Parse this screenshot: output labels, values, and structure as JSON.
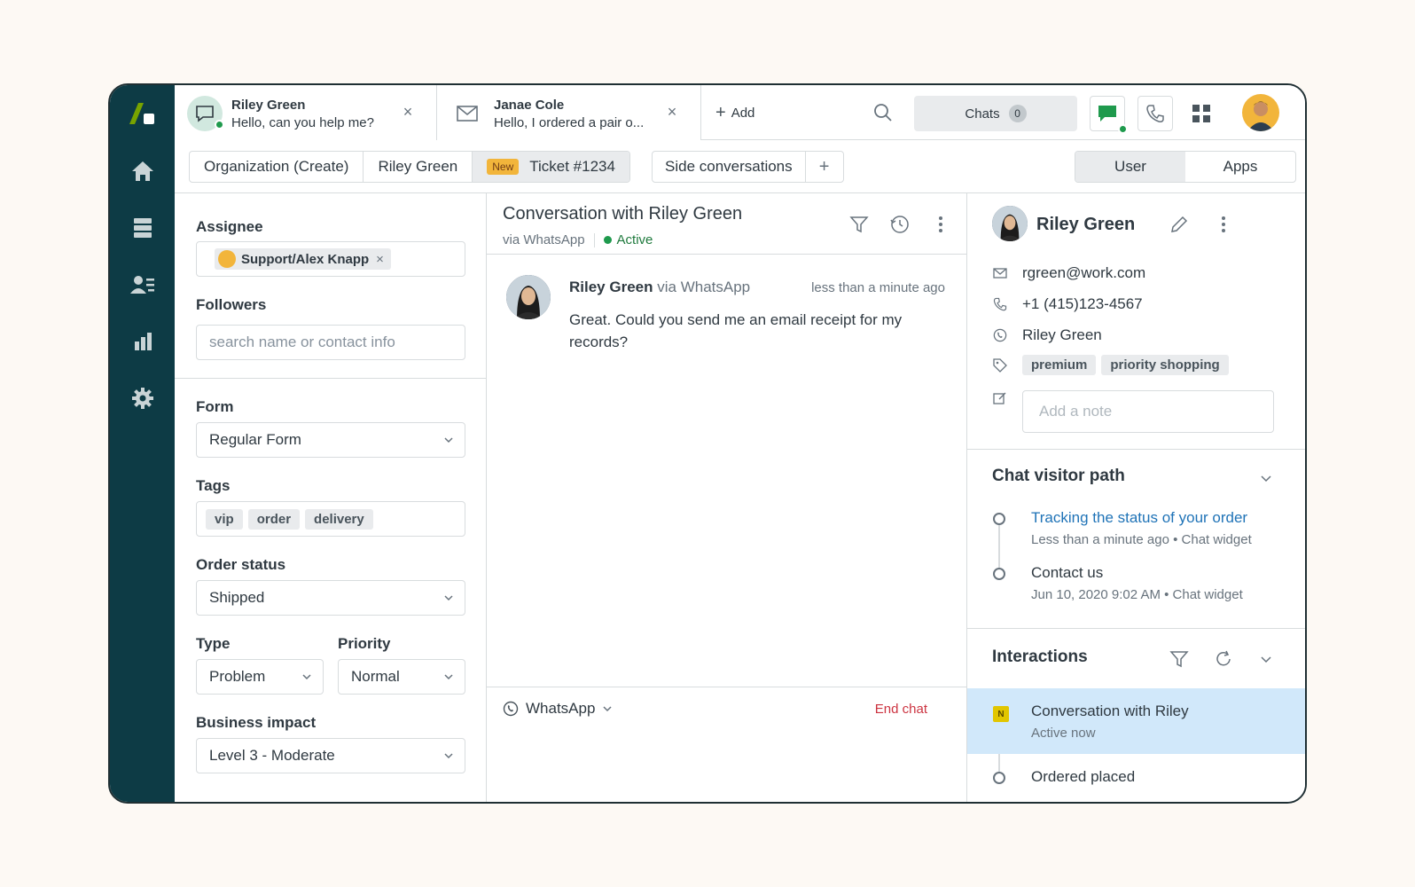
{
  "tabs": [
    {
      "name": "Riley Green",
      "preview": "Hello, can you help me?",
      "icon": "chat-bubble-icon"
    },
    {
      "name": "Janae Cole",
      "preview": "Hello, I ordered a pair o...",
      "icon": "mail-icon"
    }
  ],
  "topbar": {
    "add_label": "Add",
    "chats_label": "Chats",
    "chats_count": "0"
  },
  "subtabs": {
    "crumbs": [
      "Organization (Create)",
      "Riley Green"
    ],
    "ticket_badge": "New",
    "ticket_label": "Ticket #1234",
    "side_conversations": "Side conversations",
    "side_add": "+",
    "segments": [
      "User",
      "Apps"
    ]
  },
  "form": {
    "assignee_label": "Assignee",
    "assignee_value": "Support/Alex Knapp",
    "followers_label": "Followers",
    "followers_placeholder": "search name or contact info",
    "form_label": "Form",
    "form_value": "Regular Form",
    "tags_label": "Tags",
    "tags": [
      "vip",
      "order",
      "delivery"
    ],
    "order_status_label": "Order status",
    "order_status_value": "Shipped",
    "type_label": "Type",
    "type_value": "Problem",
    "priority_label": "Priority",
    "priority_value": "Normal",
    "business_impact_label": "Business impact",
    "business_impact_value": "Level 3 - Moderate"
  },
  "conversation": {
    "title": "Conversation with Riley Green",
    "via": "via WhatsApp",
    "status": "Active",
    "message": {
      "author": "Riley Green",
      "via": "via WhatsApp",
      "time": "less than a minute ago",
      "body": "Great. Could you send me an email receipt for my records?"
    },
    "channel": "WhatsApp",
    "end_chat": "End chat"
  },
  "user": {
    "name": "Riley Green",
    "email": "rgreen@work.com",
    "phone": "+1 (415)123-4567",
    "whatsapp": "Riley Green",
    "tags": [
      "premium",
      "priority shopping"
    ],
    "note_placeholder": "Add a note"
  },
  "visitor_path": {
    "title": "Chat visitor path",
    "items": [
      {
        "title": "Tracking the status of your order",
        "meta": "Less than a minute ago • Chat widget"
      },
      {
        "title": "Contact us",
        "meta": "Jun 10, 2020 9:02 AM • Chat widget"
      }
    ]
  },
  "interactions": {
    "title": "Interactions",
    "items": [
      {
        "badge": "N",
        "title": "Conversation with Riley",
        "meta": "Active now"
      },
      {
        "title": "Ordered placed"
      }
    ]
  },
  "colors": {
    "nav_bg": "#0d3b45",
    "accent_green": "#1f9a4d",
    "link_blue": "#1f73b7",
    "danger_red": "#cc3340",
    "selected_row": "#d1e8fa",
    "new_badge": "#f2b53b"
  }
}
